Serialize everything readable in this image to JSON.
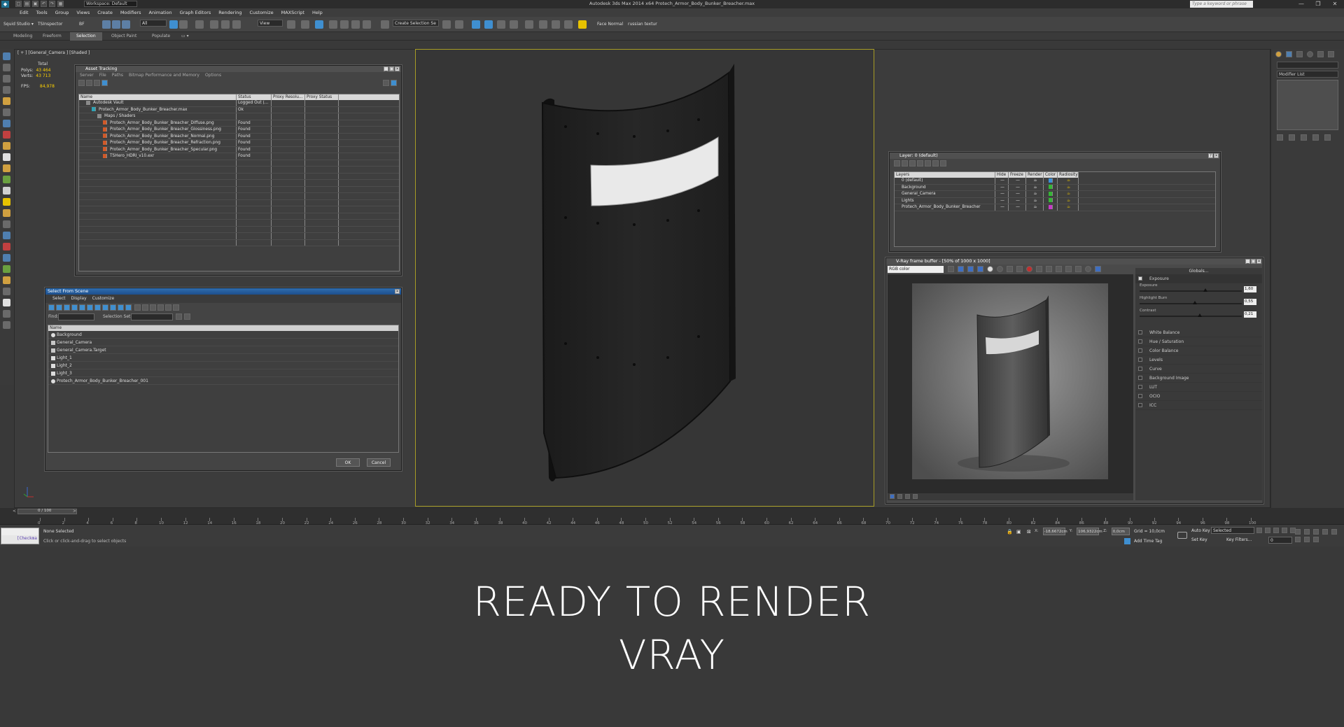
{
  "title_bar": {
    "workspace": "Workspace: Default",
    "app_title": "Autodesk 3ds Max  2014 x64     Protech_Armor_Body_Bunker_Breacher.max",
    "search_placeholder": "Type a keyword or phrase"
  },
  "menu": [
    "Edit",
    "Tools",
    "Group",
    "Views",
    "Create",
    "Modifiers",
    "Animation",
    "Graph Editors",
    "Rendering",
    "Customize",
    "MAXScript",
    "Help"
  ],
  "toolbar": {
    "left_label_1": "Squid Studio ▾",
    "left_label_2": "TSInspector",
    "left_label_3": "BF",
    "filter": "All",
    "view": "View",
    "selection_set": "Create Selection Se",
    "face_normal": "Face Normal",
    "russian": "russian textur"
  },
  "ribbon_tabs": [
    "Modeling",
    "Freeform",
    "Selection",
    "Object Paint",
    "Populate"
  ],
  "ribbon_active": "Selection",
  "viewport": {
    "label": "[ + ] [General_Camera ] [Shaded ]",
    "stats": {
      "total": "Total",
      "polys_label": "Polys:",
      "polys": "43 464",
      "verts_label": "Verts:",
      "verts": "43 713",
      "fps_label": "FPS:",
      "fps": "84,978"
    }
  },
  "asset_tracking": {
    "title": "Asset Tracking",
    "menus": [
      "Server",
      "File",
      "Paths",
      "Bitmap Performance and Memory",
      "Options"
    ],
    "columns": [
      "Name",
      "Status",
      "Proxy Resolu...",
      "Proxy Status"
    ],
    "rows": [
      {
        "name": "Autodesk Vault",
        "status": "Logged Out (...",
        "indent": 1
      },
      {
        "name": "Protech_Armor_Body_Bunker_Breacher.max",
        "status": "Ok",
        "indent": 2
      },
      {
        "name": "Maps / Shaders",
        "status": "",
        "indent": 3
      },
      {
        "name": "Protech_Armor_Body_Bunker_Breacher_Diffuse.png",
        "status": "Found",
        "indent": 4
      },
      {
        "name": "Protech_Armor_Body_Bunker_Breacher_Glossiness.png",
        "status": "Found",
        "indent": 4
      },
      {
        "name": "Protech_Armor_Body_Bunker_Breacher_Normal.png",
        "status": "Found",
        "indent": 4
      },
      {
        "name": "Protech_Armor_Body_Bunker_Breacher_Refraction.png",
        "status": "Found",
        "indent": 4
      },
      {
        "name": "Protech_Armor_Body_Bunker_Breacher_Specular.png",
        "status": "Found",
        "indent": 4
      },
      {
        "name": "TSHero_HDRI_v10.exr",
        "status": "Found",
        "indent": 4
      }
    ]
  },
  "select_from_scene": {
    "title": "Select From Scene",
    "menus": [
      "Select",
      "Display",
      "Customize"
    ],
    "find_label": "Find:",
    "selection_set_label": "Selection Set:",
    "name_header": "Name",
    "items": [
      "Background",
      "General_Camera",
      "General_Camera.Target",
      "Light_1",
      "Light_2",
      "Light_3",
      "Protech_Armor_Body_Bunker_Breacher_001"
    ],
    "ok": "OK",
    "cancel": "Cancel"
  },
  "layer_manager": {
    "title": "Layer: 0 (default)",
    "columns": [
      "Layers",
      "Hide",
      "Freeze",
      "Render",
      "Color",
      "Radiosity"
    ],
    "rows": [
      "0 (default)",
      "Background",
      "General_Camera",
      "Lights",
      "Protech_Armor_Body_Bunker_Breacher"
    ],
    "colors": [
      "#3a8fd8",
      "#35b535",
      "#35b535",
      "#35b535",
      "#c83ac8"
    ]
  },
  "vfb": {
    "title": "V-Ray frame buffer - [50% of 1000 x 1000]",
    "channel": "RGB color",
    "panel_title": "Globals...",
    "exposure_label": "Exposure",
    "sliders": [
      {
        "label": "Exposure",
        "value": "1,60"
      },
      {
        "label": "Highlight Burn",
        "value": "0,55"
      },
      {
        "label": "Contrast",
        "value": "0,21"
      }
    ],
    "corrections": [
      "White Balance",
      "Hue / Saturation",
      "Color Balance",
      "Levels",
      "Curve",
      "Background Image",
      "LUT",
      "OCIO",
      "ICC"
    ]
  },
  "command_panel": {
    "modifier_list": "Modifier List"
  },
  "timeline": {
    "range": "0 / 100",
    "ticks": [
      "0",
      "2",
      "4",
      "6",
      "8",
      "10",
      "12",
      "14",
      "16",
      "18",
      "20",
      "22",
      "24",
      "26",
      "28",
      "30",
      "32",
      "34",
      "36",
      "38",
      "40",
      "42",
      "44",
      "46",
      "48",
      "50",
      "52",
      "54",
      "56",
      "58",
      "60",
      "62",
      "64",
      "66",
      "68",
      "70",
      "72",
      "74",
      "76",
      "78",
      "80",
      "82",
      "84",
      "86",
      "88",
      "90",
      "92",
      "94",
      "96",
      "98",
      "100"
    ]
  },
  "status": {
    "selection": "None Selected",
    "prompt": "Click or click-and-drag to select objects",
    "x": "-18,6672cm",
    "y": "106,9322cm",
    "z": "0,0cm",
    "grid": "Grid = 10,0cm",
    "auto_key": "Auto Key",
    "selected": "Selected",
    "set_key": "Set Key",
    "key_filters": "Key Filters...",
    "add_time_tag": "Add Time Tag",
    "frame": "0",
    "maxscript": "[Checkma"
  },
  "caption": {
    "line1": "READY TO RENDER",
    "line2": "VRAY"
  }
}
